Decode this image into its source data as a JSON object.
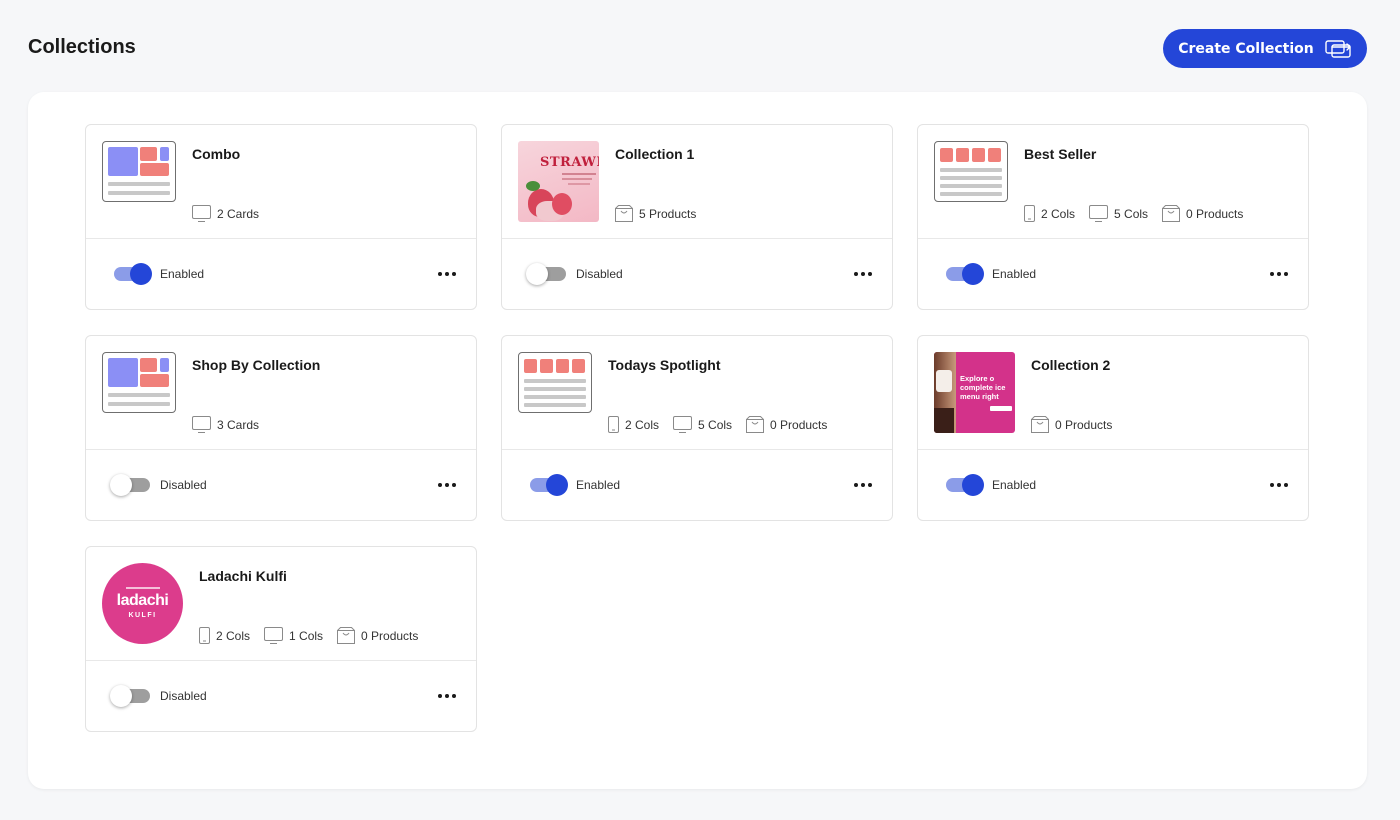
{
  "header": {
    "title": "Collections",
    "create_label": "Create Collection"
  },
  "colors": {
    "accent": "#2446d8",
    "toggle_on_track": "#8b9ce8",
    "toggle_off_track": "#9e9e9e",
    "thumb_blue": "#8b8ff5",
    "thumb_red": "#f0807a"
  },
  "collections": [
    {
      "title": "Combo",
      "thumb": "layout-cards-icon",
      "meta": [
        {
          "icon": "desktop-icon",
          "label": "2 Cards"
        }
      ],
      "enabled": true,
      "status": "Enabled"
    },
    {
      "title": "Collection 1",
      "thumb": "strawberry-image",
      "thumb_text": "STRAWBE",
      "meta": [
        {
          "icon": "bag-icon",
          "label": "5 Products"
        }
      ],
      "enabled": false,
      "status": "Disabled"
    },
    {
      "title": "Best Seller",
      "thumb": "layout-grid-icon",
      "meta": [
        {
          "icon": "mobile-icon",
          "label": "2 Cols"
        },
        {
          "icon": "desktop-icon",
          "label": "5 Cols"
        },
        {
          "icon": "bag-icon",
          "label": "0 Products"
        }
      ],
      "enabled": true,
      "status": "Enabled"
    },
    {
      "title": "Shop By Collection",
      "thumb": "layout-cards-icon",
      "meta": [
        {
          "icon": "desktop-icon",
          "label": "3 Cards"
        }
      ],
      "enabled": false,
      "status": "Disabled"
    },
    {
      "title": "Todays Spotlight",
      "thumb": "layout-grid-icon",
      "meta": [
        {
          "icon": "mobile-icon",
          "label": "2 Cols"
        },
        {
          "icon": "desktop-icon",
          "label": "5 Cols"
        },
        {
          "icon": "bag-icon",
          "label": "0 Products"
        }
      ],
      "enabled": true,
      "status": "Enabled"
    },
    {
      "title": "Collection 2",
      "thumb": "icecream-banner-image",
      "thumb_text": "Explore o complete ice menu right",
      "meta": [
        {
          "icon": "bag-icon",
          "label": "0 Products"
        }
      ],
      "enabled": true,
      "status": "Enabled"
    },
    {
      "title": "Ladachi Kulfi",
      "thumb": "ladachi-logo",
      "thumb_text": "ladachi",
      "thumb_subtext": "KULFI",
      "meta": [
        {
          "icon": "mobile-icon",
          "label": "2 Cols"
        },
        {
          "icon": "desktop-icon",
          "label": "1 Cols"
        },
        {
          "icon": "bag-icon",
          "label": "0 Products"
        }
      ],
      "enabled": false,
      "status": "Disabled"
    }
  ]
}
